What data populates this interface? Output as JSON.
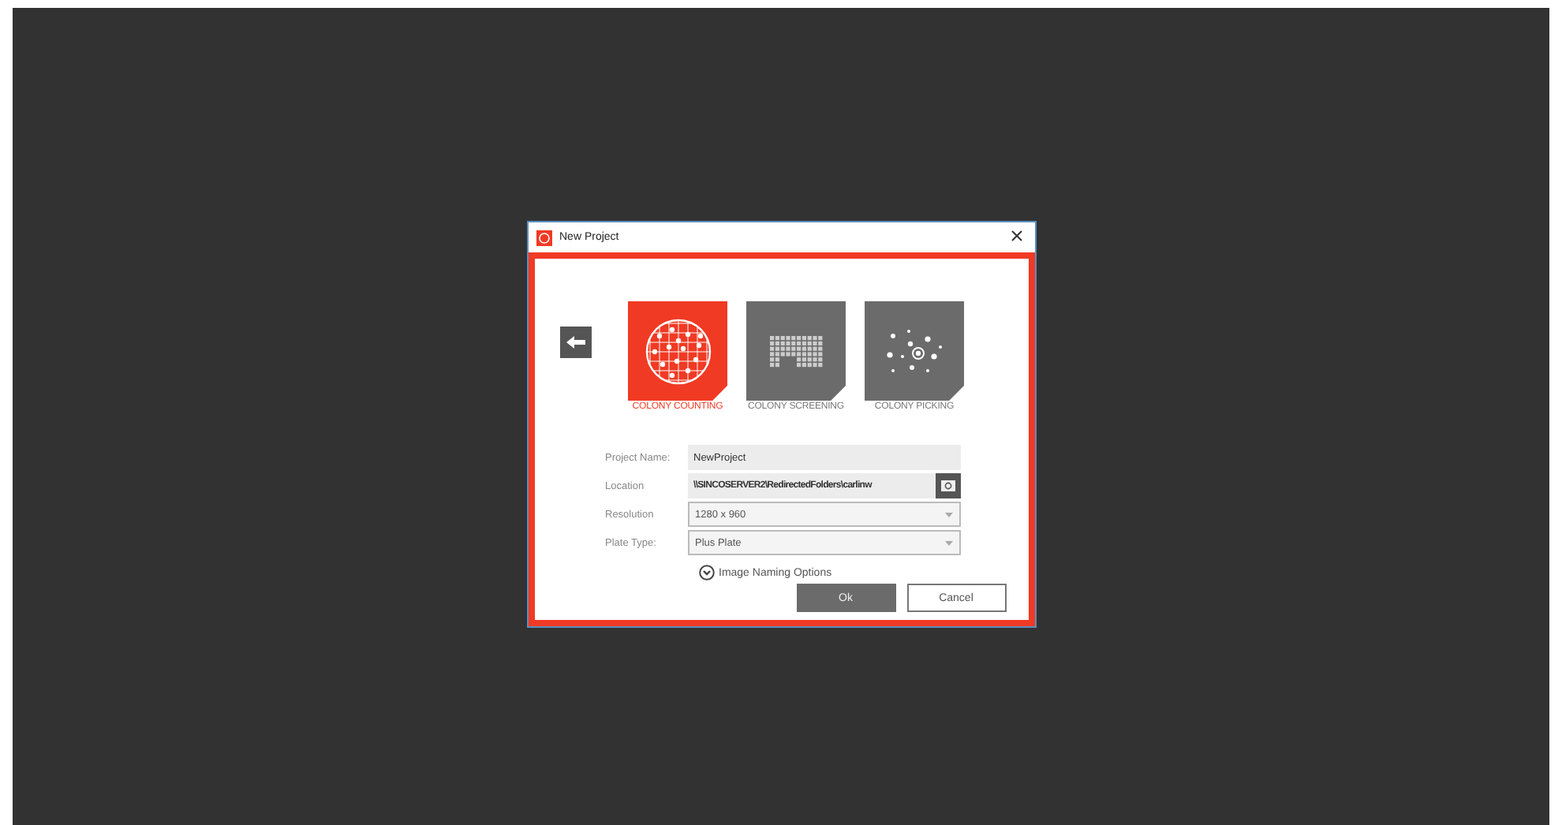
{
  "window": {
    "title": "New Project"
  },
  "project_types": [
    {
      "label": "COLONY COUNTING",
      "selected": true,
      "kind": "counting"
    },
    {
      "label": "COLONY SCREENING",
      "selected": false,
      "kind": "screening"
    },
    {
      "label": "COLONY PICKING",
      "selected": false,
      "kind": "picking"
    }
  ],
  "fields": [
    {
      "label": "Project Name:",
      "value": "NewProject",
      "kind": "text"
    },
    {
      "label": "Location",
      "value": "\\\\SINCOSERVER2\\RedirectedFolders\\carlinw",
      "kind": "path"
    },
    {
      "label": "Resolution",
      "value": "1280 x 960",
      "kind": "dropdown"
    },
    {
      "label": "Plate Type:",
      "value": "Plus Plate",
      "kind": "dropdown"
    }
  ],
  "options_toggle": {
    "label": "Image Naming Options",
    "expanded": false
  },
  "buttons": [
    {
      "label": "Ok",
      "kind": "primary"
    },
    {
      "label": "Cancel",
      "kind": "secondary"
    }
  ]
}
